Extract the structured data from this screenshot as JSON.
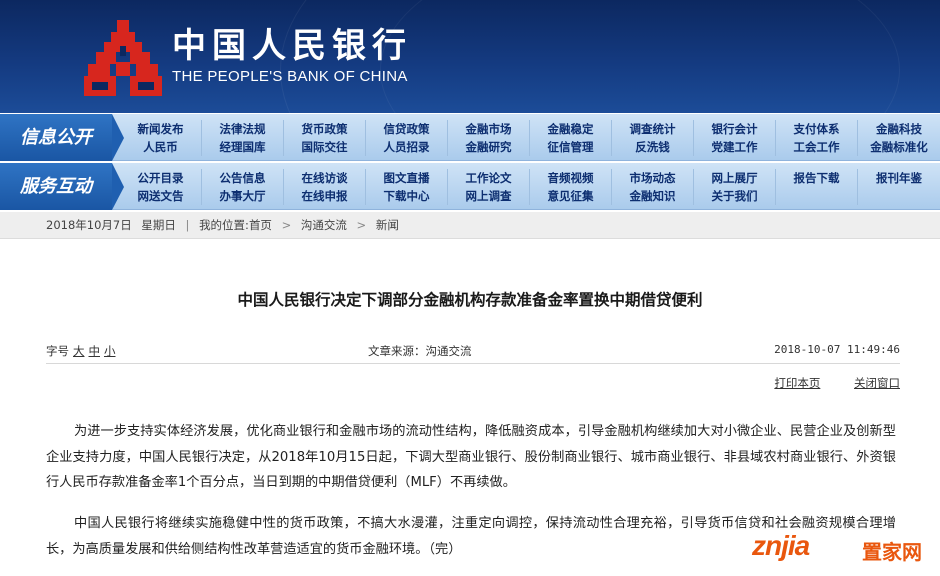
{
  "header": {
    "name_cn": "中国人民银行",
    "name_en": "THE PEOPLE'S BANK OF CHINA"
  },
  "nav_info": {
    "label": "信息公开",
    "columns": [
      [
        "新闻发布",
        "人民币"
      ],
      [
        "法律法规",
        "经理国库"
      ],
      [
        "货币政策",
        "国际交往"
      ],
      [
        "信贷政策",
        "人员招录"
      ],
      [
        "金融市场",
        "金融研究"
      ],
      [
        "金融稳定",
        "征信管理"
      ],
      [
        "调查统计",
        "反洗钱"
      ],
      [
        "银行会计",
        "党建工作"
      ],
      [
        "支付体系",
        "工会工作"
      ],
      [
        "金融科技",
        "金融标准化"
      ]
    ]
  },
  "nav_service": {
    "label": "服务互动",
    "columns": [
      [
        "公开目录",
        "网送文告"
      ],
      [
        "公告信息",
        "办事大厅"
      ],
      [
        "在线访谈",
        "在线申报"
      ],
      [
        "图文直播",
        "下载中心"
      ],
      [
        "工作论文",
        "网上调查"
      ],
      [
        "音频视频",
        "意见征集"
      ],
      [
        "市场动态",
        "金融知识"
      ],
      [
        "网上展厅",
        "关于我们"
      ],
      [
        "报告下载",
        ""
      ],
      [
        "报刊年鉴",
        ""
      ]
    ]
  },
  "breadcrumb": {
    "date": "2018年10月7日",
    "weekday": "星期日",
    "location_label": "我的位置:",
    "items": [
      "首页",
      "沟通交流",
      "新闻"
    ]
  },
  "article": {
    "title": "中国人民银行决定下调部分金融机构存款准备金率置换中期借贷便利",
    "font_label": "字号",
    "font_sizes": [
      "大",
      "中",
      "小"
    ],
    "source": "文章来源：沟通交流",
    "datetime": "2018-10-07  11:49:46",
    "print_label": "打印本页",
    "close_label": "关闭窗口",
    "paragraphs": [
      "为进一步支持实体经济发展，优化商业银行和金融市场的流动性结构，降低融资成本，引导金融机构继续加大对小微企业、民营企业及创新型企业支持力度，中国人民银行决定，从2018年10月15日起，下调大型商业银行、股份制商业银行、城市商业银行、非县域农村商业银行、外资银行人民币存款准备金率1个百分点，当日到期的中期借贷便利（MLF）不再续做。",
      "中国人民银行将继续实施稳健中性的货币政策，不搞大水漫灌，注重定向调控，保持流动性合理充裕，引导货币信贷和社会融资规模合理增长，为高质量发展和供给侧结构性改革营造适宜的货币金融环境。（完）"
    ]
  },
  "watermark": {
    "latin": "znjia",
    "cn": "置家网"
  },
  "colors": {
    "banner": "#143a80",
    "logo_red": "#d7261e",
    "nav_tag": "#1a56a4",
    "watermark": "#e9570e"
  }
}
